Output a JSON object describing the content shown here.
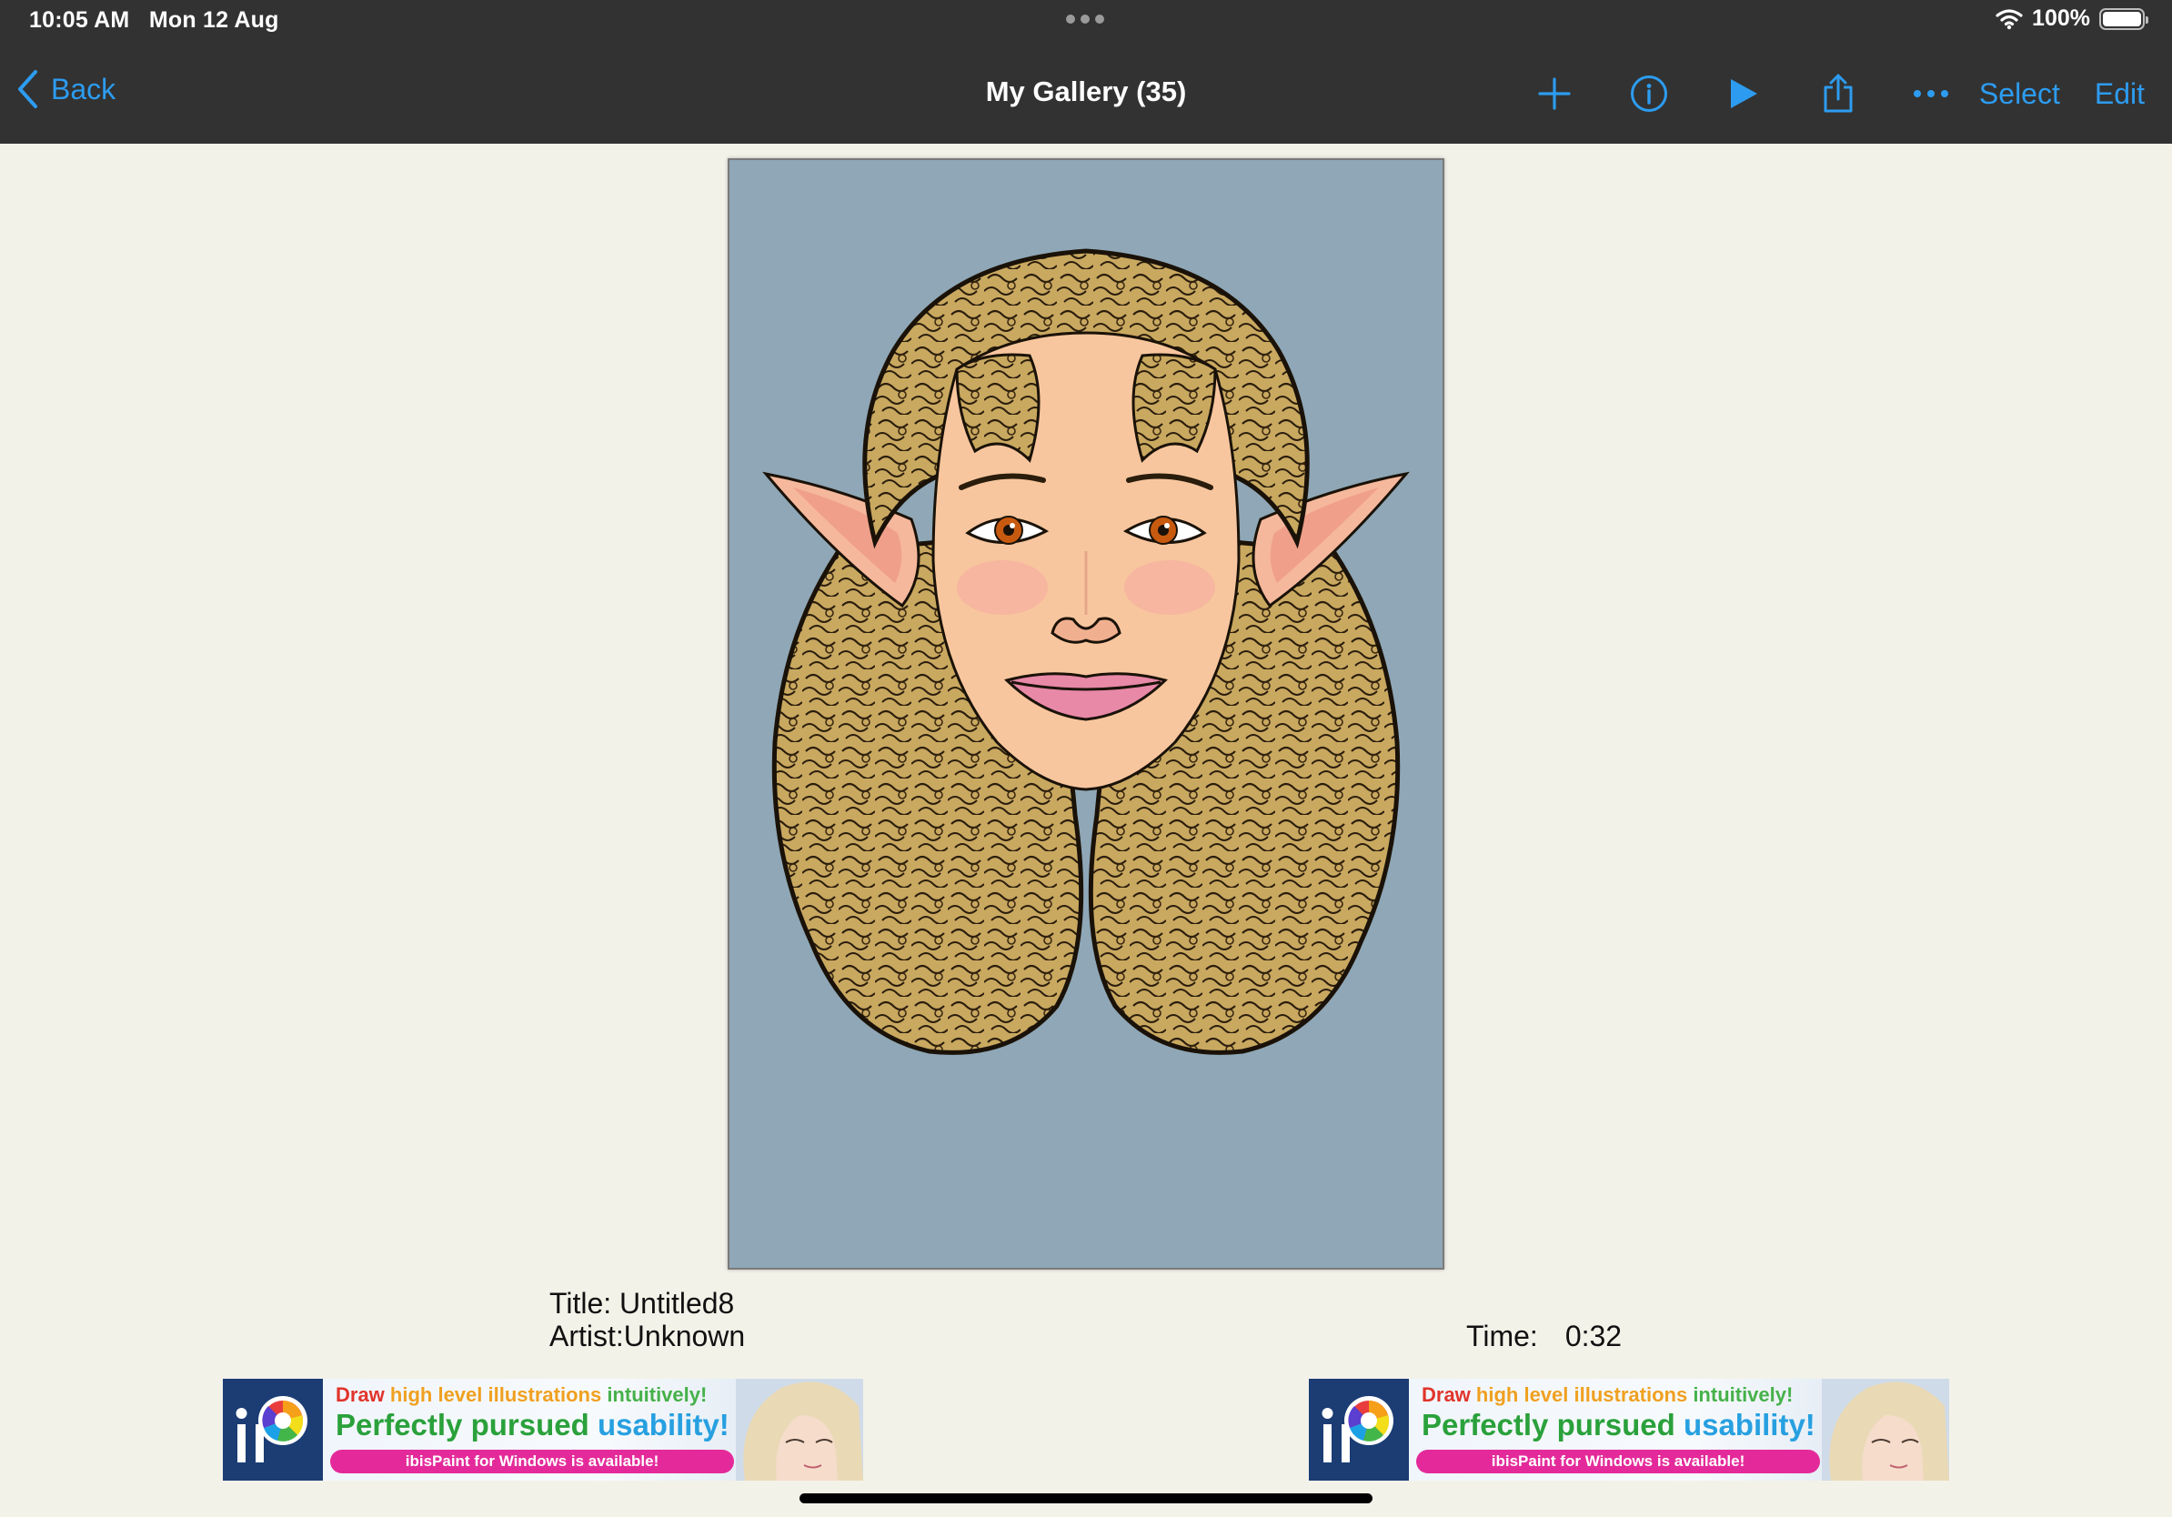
{
  "status_bar": {
    "time": "10:05 AM",
    "date": "Mon 12 Aug",
    "battery": "100%"
  },
  "nav": {
    "back_label": "Back",
    "title": "My Gallery (35)",
    "select_label": "Select",
    "edit_label": "Edit",
    "icons": [
      "plus-icon",
      "info-icon",
      "play-icon",
      "share-icon",
      "more-icon"
    ]
  },
  "artwork": {
    "canvas_color": "#8fa7b6",
    "hair_color": "#c9a860",
    "skin_color": "#f8c69e"
  },
  "meta": {
    "title": "Title: Untitled8",
    "artist": "Artist:Unknown",
    "time_label": "Time:",
    "time_value": "0:32"
  },
  "ads": [
    {
      "line1_a": "Draw ",
      "line1_b": "high level illustrations ",
      "line1_c": "intuitively!",
      "line2_a": "Perfectly pursued ",
      "line2_b": "usability!",
      "pill": "ibisPaint for Windows is available!"
    },
    {
      "line1_a": "Draw ",
      "line1_b": "high level illustrations ",
      "line1_c": "intuitively!",
      "line2_a": "Perfectly pursued ",
      "line2_b": "usability!",
      "pill": "ibisPaint for Windows is available!"
    }
  ],
  "colors": {
    "accent": "#2d9cf0",
    "topbar": "#323232",
    "background": "#f3f2e9",
    "ad_pink": "#e42a9a"
  }
}
